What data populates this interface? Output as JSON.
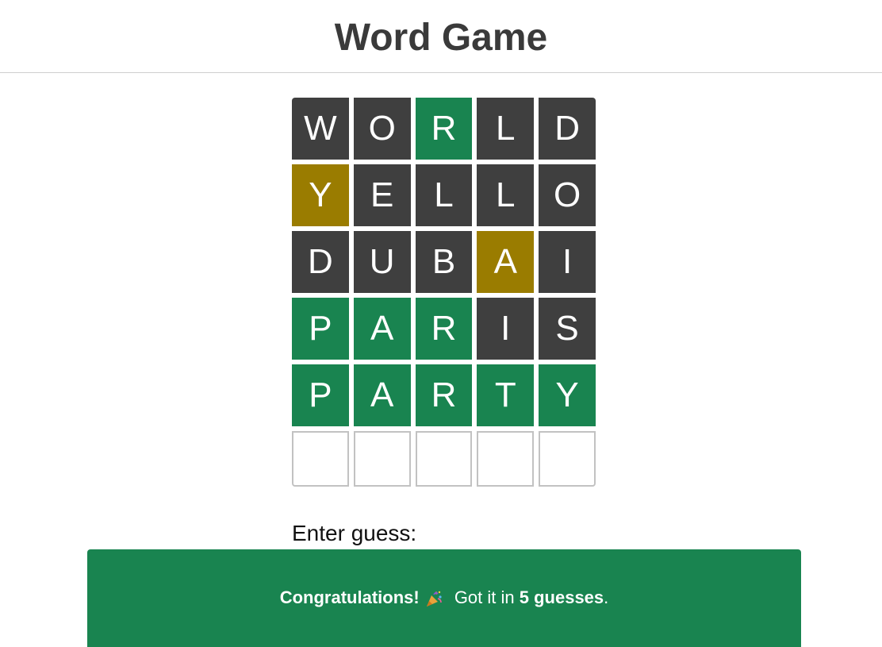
{
  "header": {
    "title": "Word Game"
  },
  "colors": {
    "absent": "#3f3f3f",
    "correct": "#198450",
    "present": "#9a7c00",
    "empty_border": "#c2c2c2",
    "banner": "#198450"
  },
  "board": {
    "rows": [
      {
        "tiles": [
          {
            "letter": "W",
            "state": "absent"
          },
          {
            "letter": "O",
            "state": "absent"
          },
          {
            "letter": "R",
            "state": "correct"
          },
          {
            "letter": "L",
            "state": "absent"
          },
          {
            "letter": "D",
            "state": "absent"
          }
        ]
      },
      {
        "tiles": [
          {
            "letter": "Y",
            "state": "present"
          },
          {
            "letter": "E",
            "state": "absent"
          },
          {
            "letter": "L",
            "state": "absent"
          },
          {
            "letter": "L",
            "state": "absent"
          },
          {
            "letter": "O",
            "state": "absent"
          }
        ]
      },
      {
        "tiles": [
          {
            "letter": "D",
            "state": "absent"
          },
          {
            "letter": "U",
            "state": "absent"
          },
          {
            "letter": "B",
            "state": "absent"
          },
          {
            "letter": "A",
            "state": "present"
          },
          {
            "letter": "I",
            "state": "absent"
          }
        ]
      },
      {
        "tiles": [
          {
            "letter": "P",
            "state": "correct"
          },
          {
            "letter": "A",
            "state": "correct"
          },
          {
            "letter": "R",
            "state": "correct"
          },
          {
            "letter": "I",
            "state": "absent"
          },
          {
            "letter": "S",
            "state": "absent"
          }
        ]
      },
      {
        "tiles": [
          {
            "letter": "P",
            "state": "correct"
          },
          {
            "letter": "A",
            "state": "correct"
          },
          {
            "letter": "R",
            "state": "correct"
          },
          {
            "letter": "T",
            "state": "correct"
          },
          {
            "letter": "Y",
            "state": "correct"
          }
        ]
      },
      {
        "tiles": [
          {
            "letter": "",
            "state": "empty"
          },
          {
            "letter": "",
            "state": "empty"
          },
          {
            "letter": "",
            "state": "empty"
          },
          {
            "letter": "",
            "state": "empty"
          },
          {
            "letter": "",
            "state": "empty"
          }
        ]
      }
    ]
  },
  "input": {
    "label": "Enter guess:"
  },
  "result": {
    "congrats": "Congratulations!",
    "icon": "party-popper-icon",
    "middle_text": " Got it in ",
    "guess_count_text": "5 guesses",
    "end_text": "."
  }
}
